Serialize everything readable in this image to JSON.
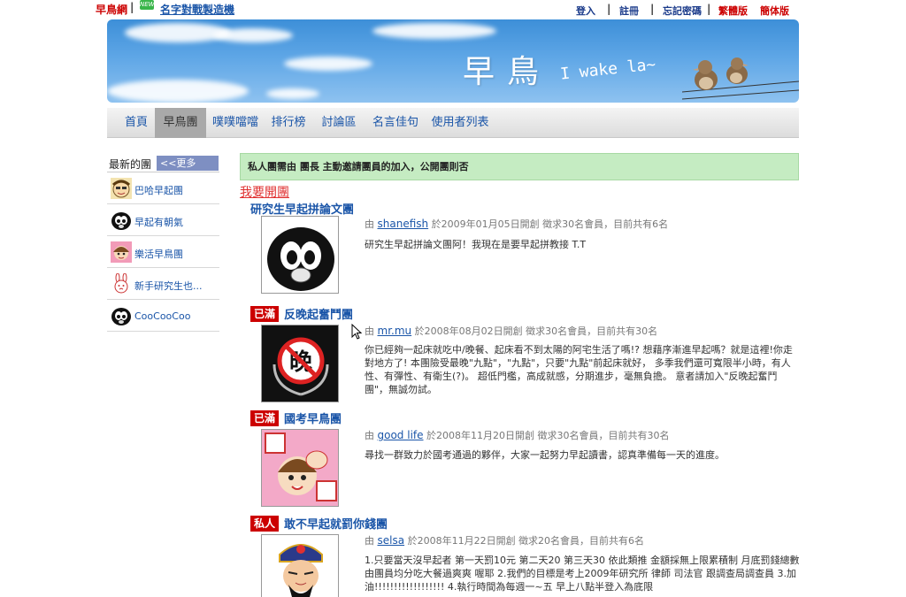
{
  "topbar": {
    "site_name": "早鳥網",
    "sep": "|",
    "new_badge": "NEW",
    "name_link": "名字對戰製造機",
    "login": "登入",
    "register": "註冊",
    "forgot": "忘記密碼",
    "traditional": "繁體版",
    "simplified": "簡体版"
  },
  "banner": {
    "title": "早鳥",
    "subtitle": "I wake la~"
  },
  "nav": {
    "items": [
      "首頁",
      "早鳥團",
      "噗噗噹噹",
      "排行榜",
      "討論區",
      "名言佳句",
      "使用者列表"
    ],
    "active": "早鳥團"
  },
  "sidebar": {
    "title": "最新的團",
    "more": "<<更多",
    "items": [
      {
        "label": "巴哈早起團",
        "icon": "cartoon-face-icon"
      },
      {
        "label": "早起有朝氣",
        "icon": "penguin-icon"
      },
      {
        "label": "樂活早鳥團",
        "icon": "cartoon-girl-icon"
      },
      {
        "label": "新手研究生也...",
        "icon": "rabbit-icon"
      },
      {
        "label": "CooCooCoo",
        "icon": "penguin-icon"
      }
    ]
  },
  "main": {
    "notice": "私人團需由 團長 主動邀請團員的加入，公開團則否",
    "open_group": "我要開團",
    "groups": [
      {
        "badge": "",
        "name": "研究生早起拼論文團",
        "prefix": "由",
        "user": "shanefish",
        "meta": "於2009年01月05日開創 徵求30名會員，目前共有6名",
        "desc": "研究生早起拼論文團阿！我現在是要早起拼教接 T.T",
        "thumb": "penguin-icon"
      },
      {
        "badge": "已滿",
        "name": "反晚起奮鬥團",
        "prefix": "由",
        "user": "mr.mu",
        "meta": "於2008年08月02日開創 徵求30名會員，目前共有30名",
        "desc": "你已經夠一起床就吃中/晚餐、起床看不到太陽的阿宅生活了嗎!? 想藉序漸進早起嗎？就是這裡!你走對地方了! 本團險受最晚\"九點\"，\"九點\"，只要\"九點\"前起床就好， 多季我們還可寬限半小時，有人性、有彈性、有衛生(?)。 超低門檻，高成就感，分期進步，毫無負擔。 意者請加入\"反晚起奮鬥團\"，無誠勿試。",
        "thumb": "no-late-icon"
      },
      {
        "badge": "已滿",
        "name": "國考早鳥團",
        "prefix": "由",
        "user": "good life",
        "meta": "於2008年11月20日開創 徵求30名會員，目前共有30名",
        "desc": "尋找一群致力於國考通過的夥伴，大家一起努力早起讀書，認真準備每一天的進度。",
        "thumb": "cheer-girl-icon"
      },
      {
        "badge": "私人",
        "name": "敢不早起就罰你錢團",
        "prefix": "由",
        "user": "selsa",
        "meta": "於2008年11月22日開創 徵求20名會員，目前共有6名",
        "desc": "1.只要當天沒早起者 第一天罰10元 第二天20 第三天30 依此類推 金額採無上限累積制 月底罰錢總數由團員均分吃大餐過爽爽 喔耶 2.我們的目標是考上2009年研究所 律師 司法官 跟調查局調查員 3.加油!!!!!!!!!!!!!!!!!! 4.執行時間為每週一~五 早上八點半登入為底限",
        "thumb": "judge-icon"
      }
    ]
  }
}
